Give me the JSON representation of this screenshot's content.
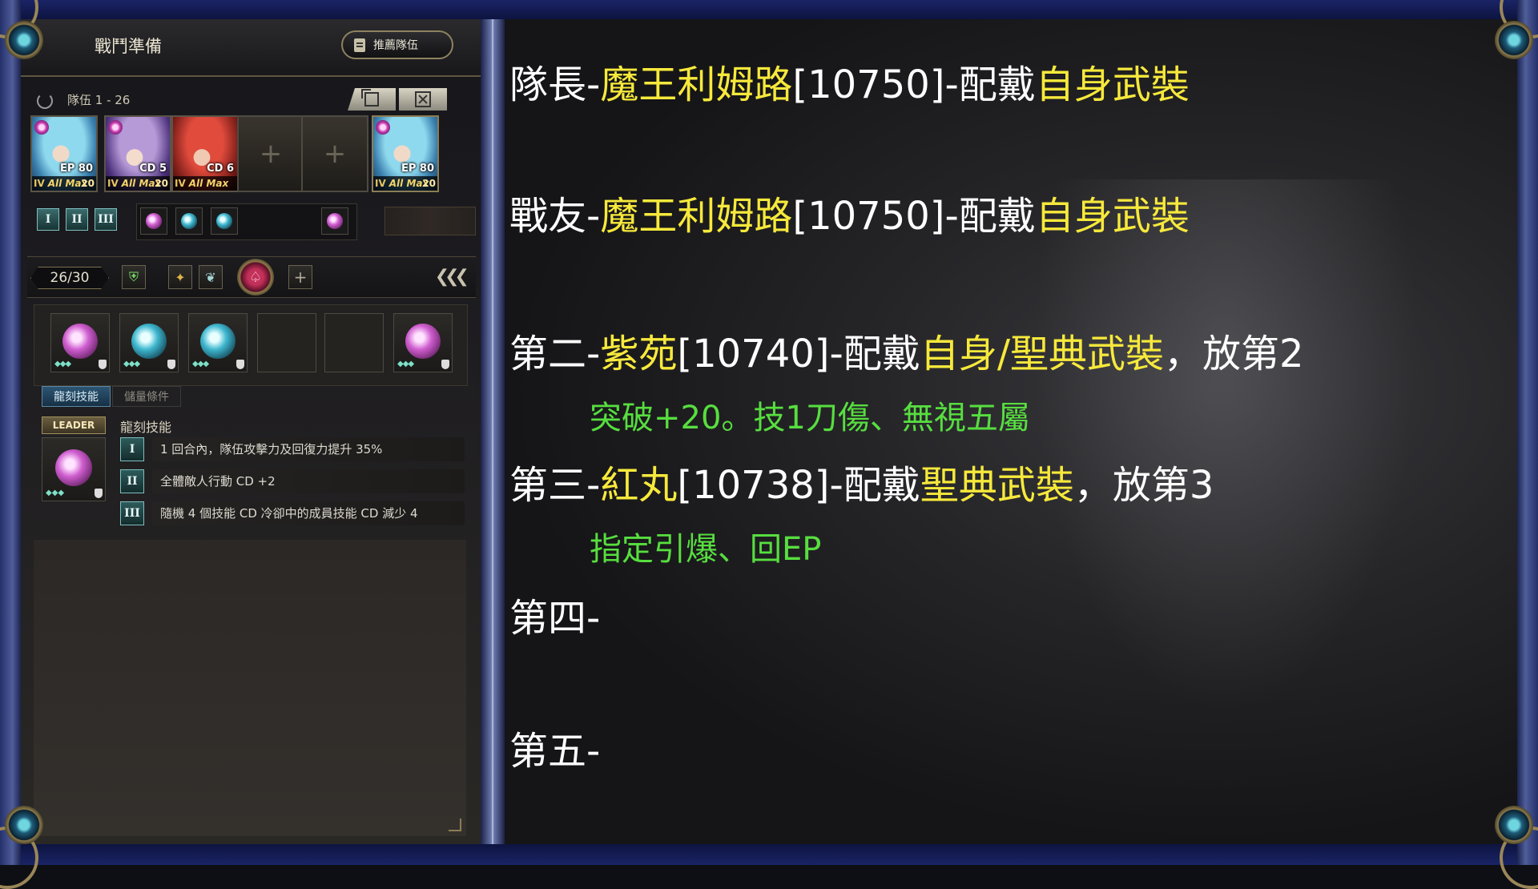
{
  "game": {
    "title": "戰鬥準備",
    "recommend_button": "推薦隊伍",
    "team_label": "隊伍 1 - 26",
    "members": [
      {
        "portrait": "blue",
        "star": true,
        "cd_text": "EP 80",
        "rank": "IV",
        "status": "All Max",
        "level": "20"
      },
      {
        "portrait": "purple",
        "star": true,
        "cd_text": "CD 5",
        "rank": "IV",
        "status": "All Max",
        "level": "20"
      },
      {
        "portrait": "red",
        "star": false,
        "cd_text": "CD 6",
        "rank": "IV",
        "status": "All Max",
        "level": ""
      },
      {
        "empty": true
      },
      {
        "empty": true
      },
      {
        "portrait": "blue",
        "star": true,
        "cd_text": "EP 80",
        "rank": "IV",
        "status": "All Max",
        "level": "20",
        "ally": true
      }
    ],
    "tiers": [
      "I",
      "II",
      "III"
    ],
    "tray_gems": [
      "pink",
      "cyan",
      "cyan",
      "pink"
    ],
    "count": "26/30",
    "slot_gems": [
      "pink",
      "cyan",
      "cyan",
      "",
      "",
      "pink"
    ],
    "tabs": {
      "active": "龍刻技能",
      "inactive": "儲量條件"
    },
    "leader_tag": "LEADER",
    "leader_heading": "龍刻技能",
    "leader_skills": [
      {
        "num": "I",
        "text": "1 回合內，隊伍攻擊力及回復力提升 35%"
      },
      {
        "num": "II",
        "text": "全體敵人行動 CD +2"
      },
      {
        "num": "III",
        "text": "隨機 4 個技能 CD 冷卻中的成員技能 CD 減少 4"
      }
    ]
  },
  "notes": {
    "line1": {
      "a": "隊長-",
      "b": "魔王利姆路",
      "c": "[10750]-配戴",
      "d": "自身武裝"
    },
    "line2": {
      "a": "戰友-",
      "b": "魔王利姆路",
      "c": "[10750]-配戴",
      "d": "自身武裝"
    },
    "line3": {
      "a": "第二-",
      "b": "紫苑",
      "c": "[10740]-配戴",
      "d": "自身/聖典武裝",
      "e": "，放第2"
    },
    "line3_sub": "突破+20。技1刀傷、無視五屬",
    "line4": {
      "a": "第三-",
      "b": "紅丸",
      "c": "[10738]-配戴",
      "d": "聖典武裝",
      "e": "，放第3"
    },
    "line4_sub": "指定引爆、回EP",
    "line5": "第四-",
    "line6": "第五-"
  },
  "colors": {
    "highlight": "#f7e93b",
    "note_green": "#57de3f",
    "frame_gold": "#9a8658"
  }
}
